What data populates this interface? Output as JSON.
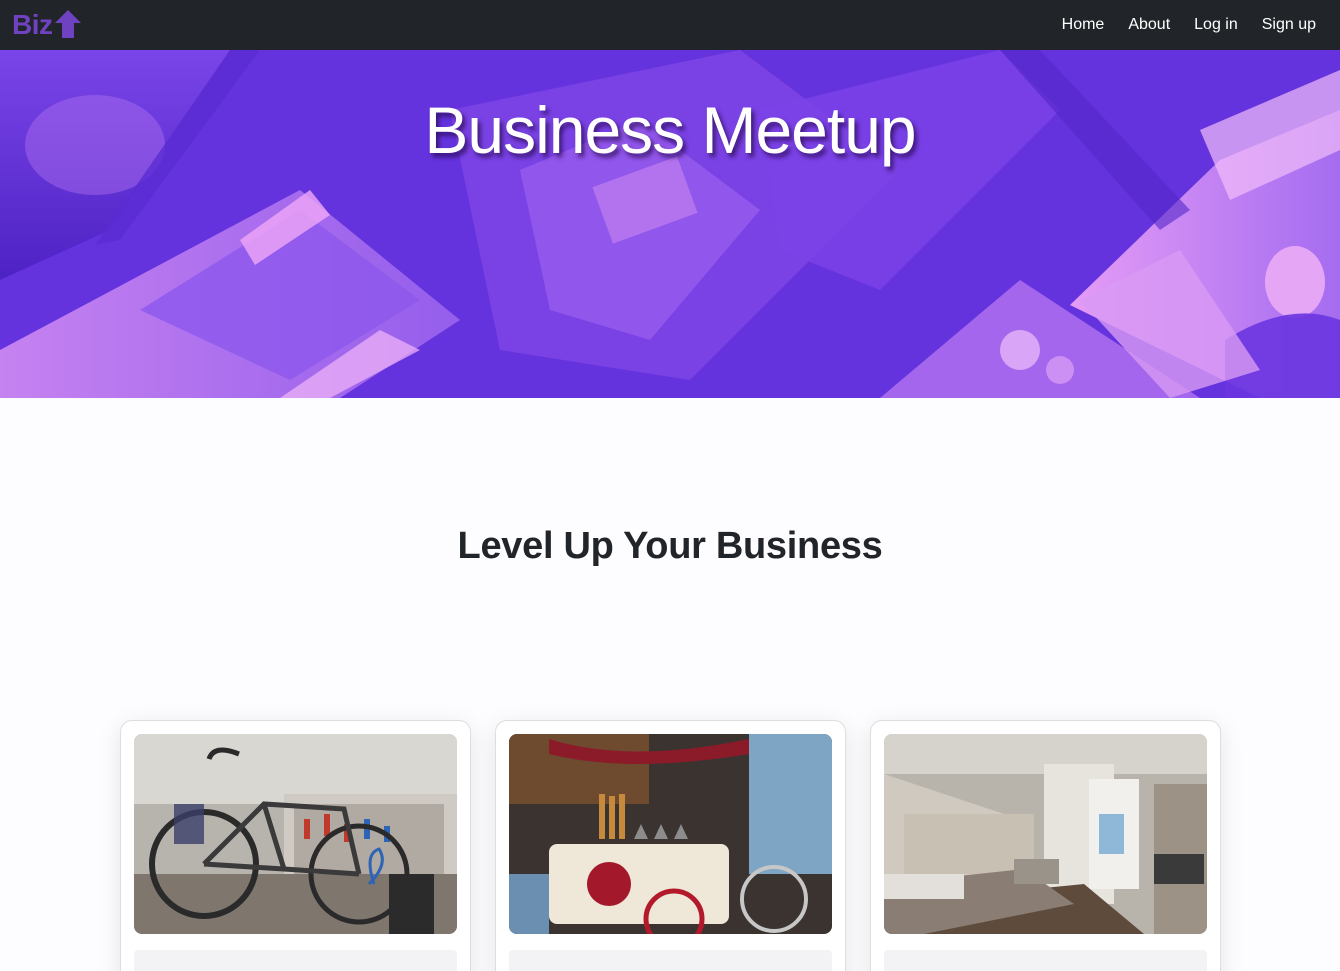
{
  "navbar": {
    "brand": "Biz",
    "brand_icon": "arrow-up-icon",
    "links": [
      {
        "label": "Home"
      },
      {
        "label": "About"
      },
      {
        "label": "Log in"
      },
      {
        "label": "Sign up"
      }
    ]
  },
  "hero": {
    "title": "Business Meetup"
  },
  "section": {
    "heading": "Level Up Your Business"
  },
  "cards": [
    {
      "image": "bike-workshop-photo"
    },
    {
      "image": "gelato-cart-photo"
    },
    {
      "image": "hotel-room-photo"
    }
  ],
  "colors": {
    "brand": "#6f42c1",
    "navbar_bg": "#212529",
    "hero_purple": "#6a35e0",
    "hero_pink": "#d98cf0"
  }
}
